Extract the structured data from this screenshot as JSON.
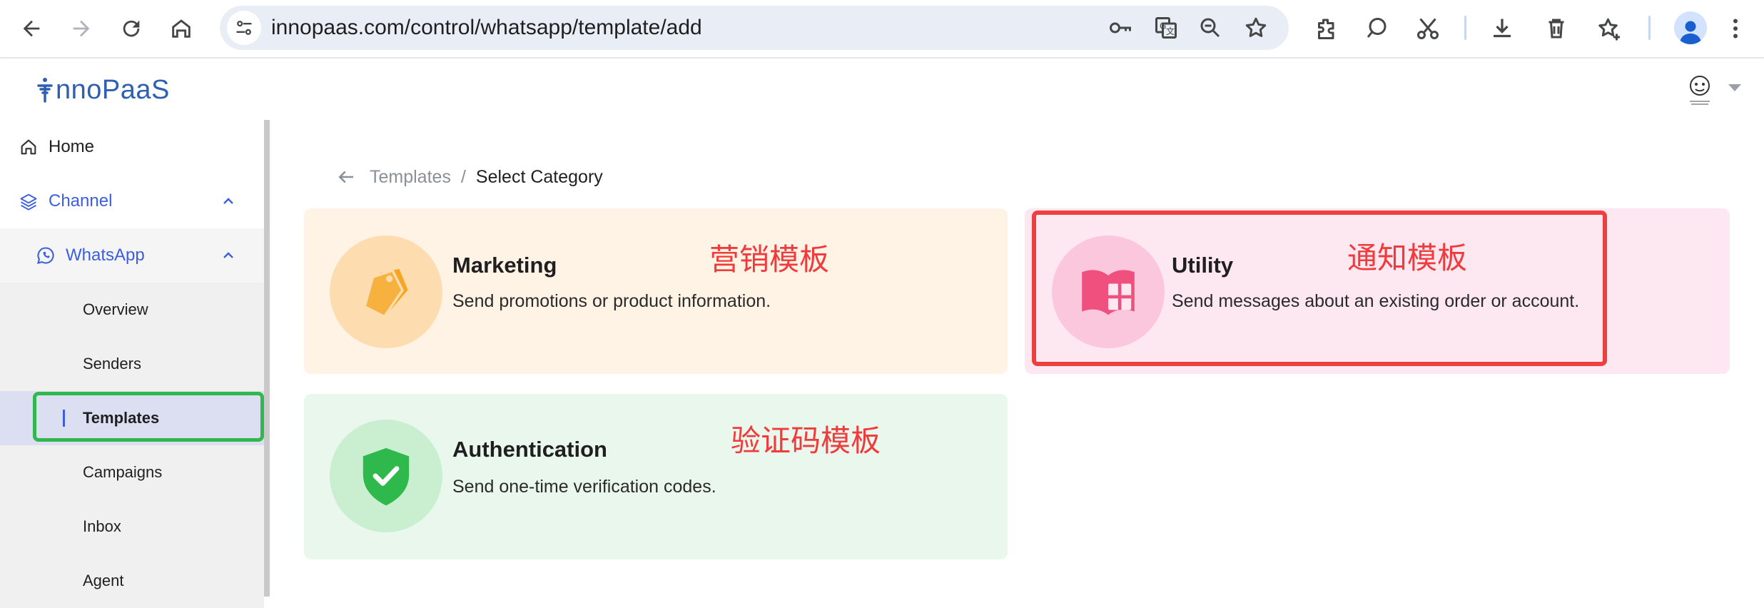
{
  "browser": {
    "url": "innopaas.com/control/whatsapp/template/add",
    "icons": [
      "back-icon",
      "forward-icon",
      "reload-icon",
      "home-icon",
      "site-settings-icon",
      "key-icon",
      "translate-icon",
      "zoom-icon",
      "bookmark-star-icon",
      "extensions-icon",
      "search-chat-icon",
      "scissors-icon",
      "download-icon",
      "trash-icon",
      "reading-list-star-icon",
      "profile-icon",
      "more-menu-icon"
    ]
  },
  "app": {
    "logo_text": "nnoPaaS"
  },
  "sidebar": {
    "home": "Home",
    "channel": "Channel",
    "whatsapp": "WhatsApp",
    "items": [
      {
        "label": "Overview"
      },
      {
        "label": "Senders"
      },
      {
        "label": "Templates"
      },
      {
        "label": "Campaigns"
      },
      {
        "label": "Inbox"
      },
      {
        "label": "Agent"
      }
    ],
    "active_item": "Templates"
  },
  "breadcrumb": {
    "parent": "Templates",
    "separator": "/",
    "current": "Select Category"
  },
  "categories": [
    {
      "title": "Marketing",
      "description": "Send promotions or product information.",
      "annotation": "营销模板",
      "bg_color": "#fff3e6",
      "icon_color": "#f5a623"
    },
    {
      "title": "Utility",
      "description": "Send messages about an existing order or account.",
      "annotation": "通知模板",
      "bg_color": "#fde8f1",
      "icon_color": "#f0507d"
    },
    {
      "title": "Authentication",
      "description": "Send one-time verification codes.",
      "annotation": "验证码模板",
      "bg_color": "#eaf7ec",
      "icon_color": "#2fb84c"
    }
  ],
  "colors": {
    "accent": "#3b5fe0",
    "highlight_red": "#ee3f3f",
    "highlight_green": "#2fb84c"
  }
}
